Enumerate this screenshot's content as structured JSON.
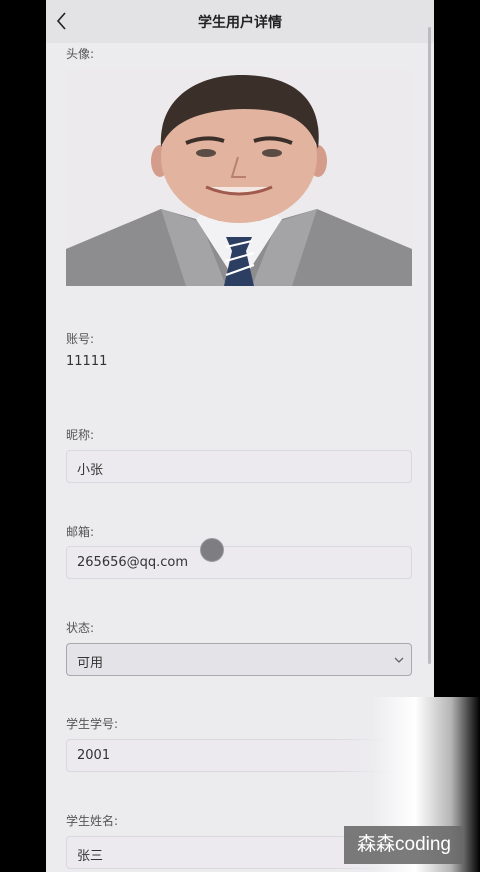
{
  "header": {
    "title": "学生用户详情"
  },
  "avatar": {
    "label": "头像:"
  },
  "account": {
    "label": "账号:",
    "value": "11111"
  },
  "nickname": {
    "label": "昵称:",
    "value": "小张"
  },
  "email": {
    "label": "邮箱:",
    "value": "265656@qq.com"
  },
  "status": {
    "label": "状态:",
    "selected": "可用"
  },
  "student_id": {
    "label": "学生学号:",
    "value": "2001"
  },
  "student_name": {
    "label": "学生姓名:",
    "value": "张三"
  },
  "watermark": {
    "text": "森森coding"
  },
  "colors": {
    "page_bg": "#ecebee",
    "header_bg": "#e3e2e5",
    "frame_bg": "#000000"
  }
}
